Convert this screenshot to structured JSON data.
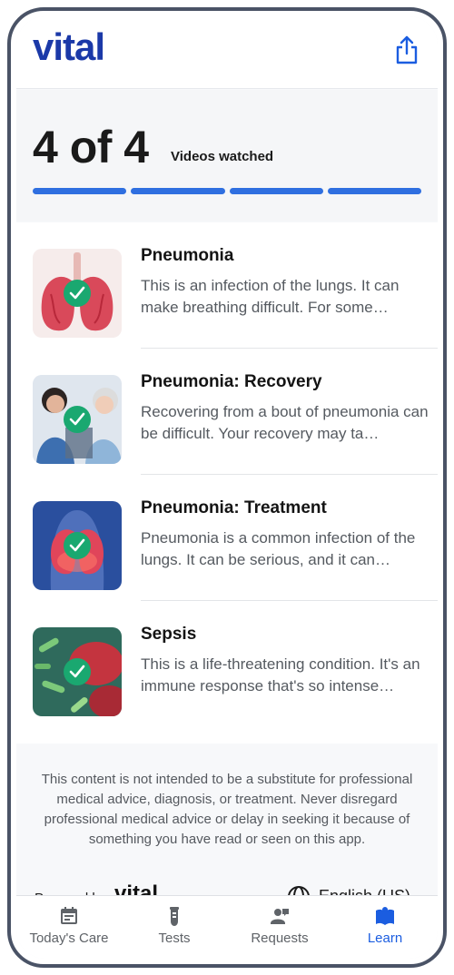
{
  "header": {
    "logo": "vital",
    "share_icon": "share-icon"
  },
  "progress": {
    "count": "4 of 4",
    "label": "Videos watched",
    "segments": 4,
    "completed": 4,
    "color": "#2f6fe0"
  },
  "videos": [
    {
      "title": "Pneumonia",
      "description": "This is an infection of the lungs. It can make breathing difficult. For some…",
      "watched": true
    },
    {
      "title": "Pneumonia: Recovery",
      "description": "Recovering from a bout of pneumonia can be difficult. Your recovery may ta…",
      "watched": true
    },
    {
      "title": "Pneumonia: Treatment",
      "description": "Pneumonia is a common infection of the lungs. It can be serious, and it can…",
      "watched": true
    },
    {
      "title": "Sepsis",
      "description": "This is a life-threatening condition. It's an immune response that's so intense…",
      "watched": true
    }
  ],
  "disclaimer": "This content is not intended to be a substitute for professional medical advice, diagnosis, or treatment. Never disregard professional medical advice or delay in seeking it because of something you have read or seen on this app.",
  "footer": {
    "powered_by": "Powered by",
    "powered_logo": "vital",
    "language": "English (US)"
  },
  "tabs": [
    {
      "label": "Today's Care",
      "icon": "calendar-icon",
      "active": false
    },
    {
      "label": "Tests",
      "icon": "test-tube-icon",
      "active": false
    },
    {
      "label": "Requests",
      "icon": "request-person-icon",
      "active": false
    },
    {
      "label": "Learn",
      "icon": "book-icon",
      "active": true
    }
  ],
  "colors": {
    "brand": "#1b39a8",
    "accent": "#1b5de0",
    "check": "#1aa870"
  }
}
